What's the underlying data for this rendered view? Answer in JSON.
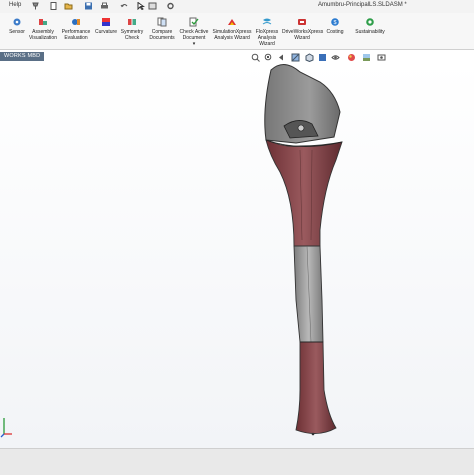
{
  "menu": {
    "help": "Help"
  },
  "window": {
    "title": "Amumbru-PrincipalLS.SLDASM *"
  },
  "ribbon": {
    "items": [
      {
        "label": "Sensor",
        "icon": "sensor-icon"
      },
      {
        "label": "Assembly\nVisualization",
        "icon": "assembly-visualization-icon"
      },
      {
        "label": "Performance\nEvaluation",
        "icon": "performance-evaluation-icon"
      },
      {
        "label": "Curvature",
        "icon": "curvature-icon"
      },
      {
        "label": "Symmetry\nCheck",
        "icon": "symmetry-check-icon"
      },
      {
        "label": "Compare\nDocuments",
        "icon": "compare-documents-icon"
      },
      {
        "label": "Check Active\nDocument",
        "icon": "check-active-document-icon"
      },
      {
        "label": "SimulationXpress\nAnalysis Wizard",
        "icon": "simulationxpress-icon"
      },
      {
        "label": "FloXpress\nAnalysis\nWizard",
        "icon": "floxpress-icon"
      },
      {
        "label": "DriveWorksXpress\nWizard",
        "icon": "driveworksxpress-icon"
      },
      {
        "label": "Costing",
        "icon": "costing-icon"
      },
      {
        "label": "Sustainability",
        "icon": "sustainability-icon"
      }
    ]
  },
  "tabs": {
    "active": "WORKS MBD"
  },
  "colors": {
    "ribbon_bg": "#f7f7f7",
    "tab_bg": "#5a6f86",
    "bone_red": "#8a4a4e",
    "bone_grey": "#8d8d8d"
  }
}
